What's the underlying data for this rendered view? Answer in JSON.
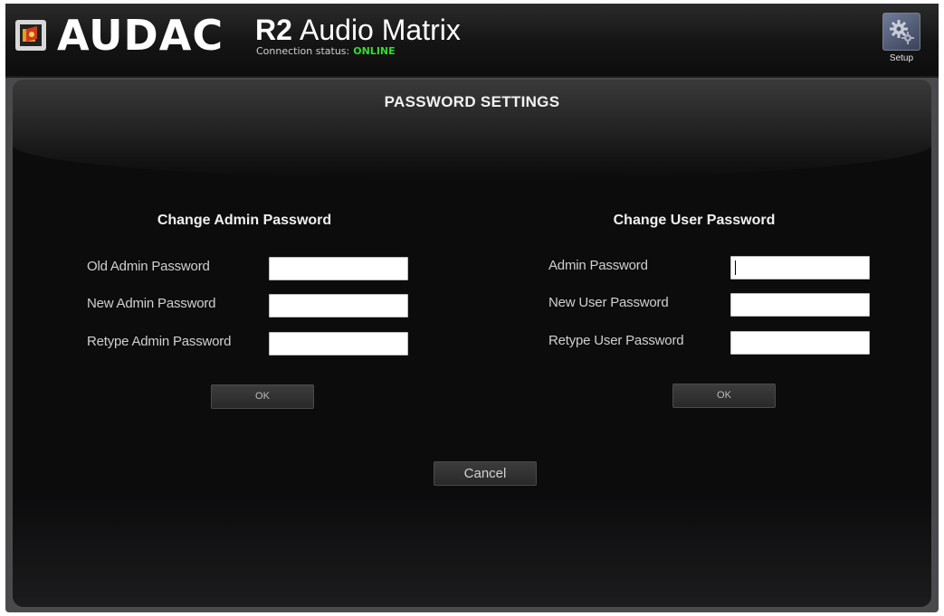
{
  "header": {
    "brand": "AUDAC",
    "model": "R2",
    "product": "Audio Matrix",
    "status_label": "Connection status:",
    "status_value": "ONLINE",
    "status_color": "#35d935",
    "setup_label": "Setup"
  },
  "panel": {
    "title": "PASSWORD SETTINGS",
    "admin": {
      "title": "Change Admin Password",
      "fields": [
        {
          "label": "Old Admin Password",
          "value": ""
        },
        {
          "label": "New Admin Password",
          "value": ""
        },
        {
          "label": "Retype Admin Password",
          "value": ""
        }
      ],
      "ok_label": "OK"
    },
    "user": {
      "title": "Change User Password",
      "fields": [
        {
          "label": "Admin Password",
          "value": ""
        },
        {
          "label": "New User Password",
          "value": ""
        },
        {
          "label": "Retype User Password",
          "value": ""
        }
      ],
      "ok_label": "OK"
    },
    "cancel_label": "Cancel"
  },
  "icons": {
    "logo": "audac-logo-icon",
    "setup": "gear-icon"
  }
}
